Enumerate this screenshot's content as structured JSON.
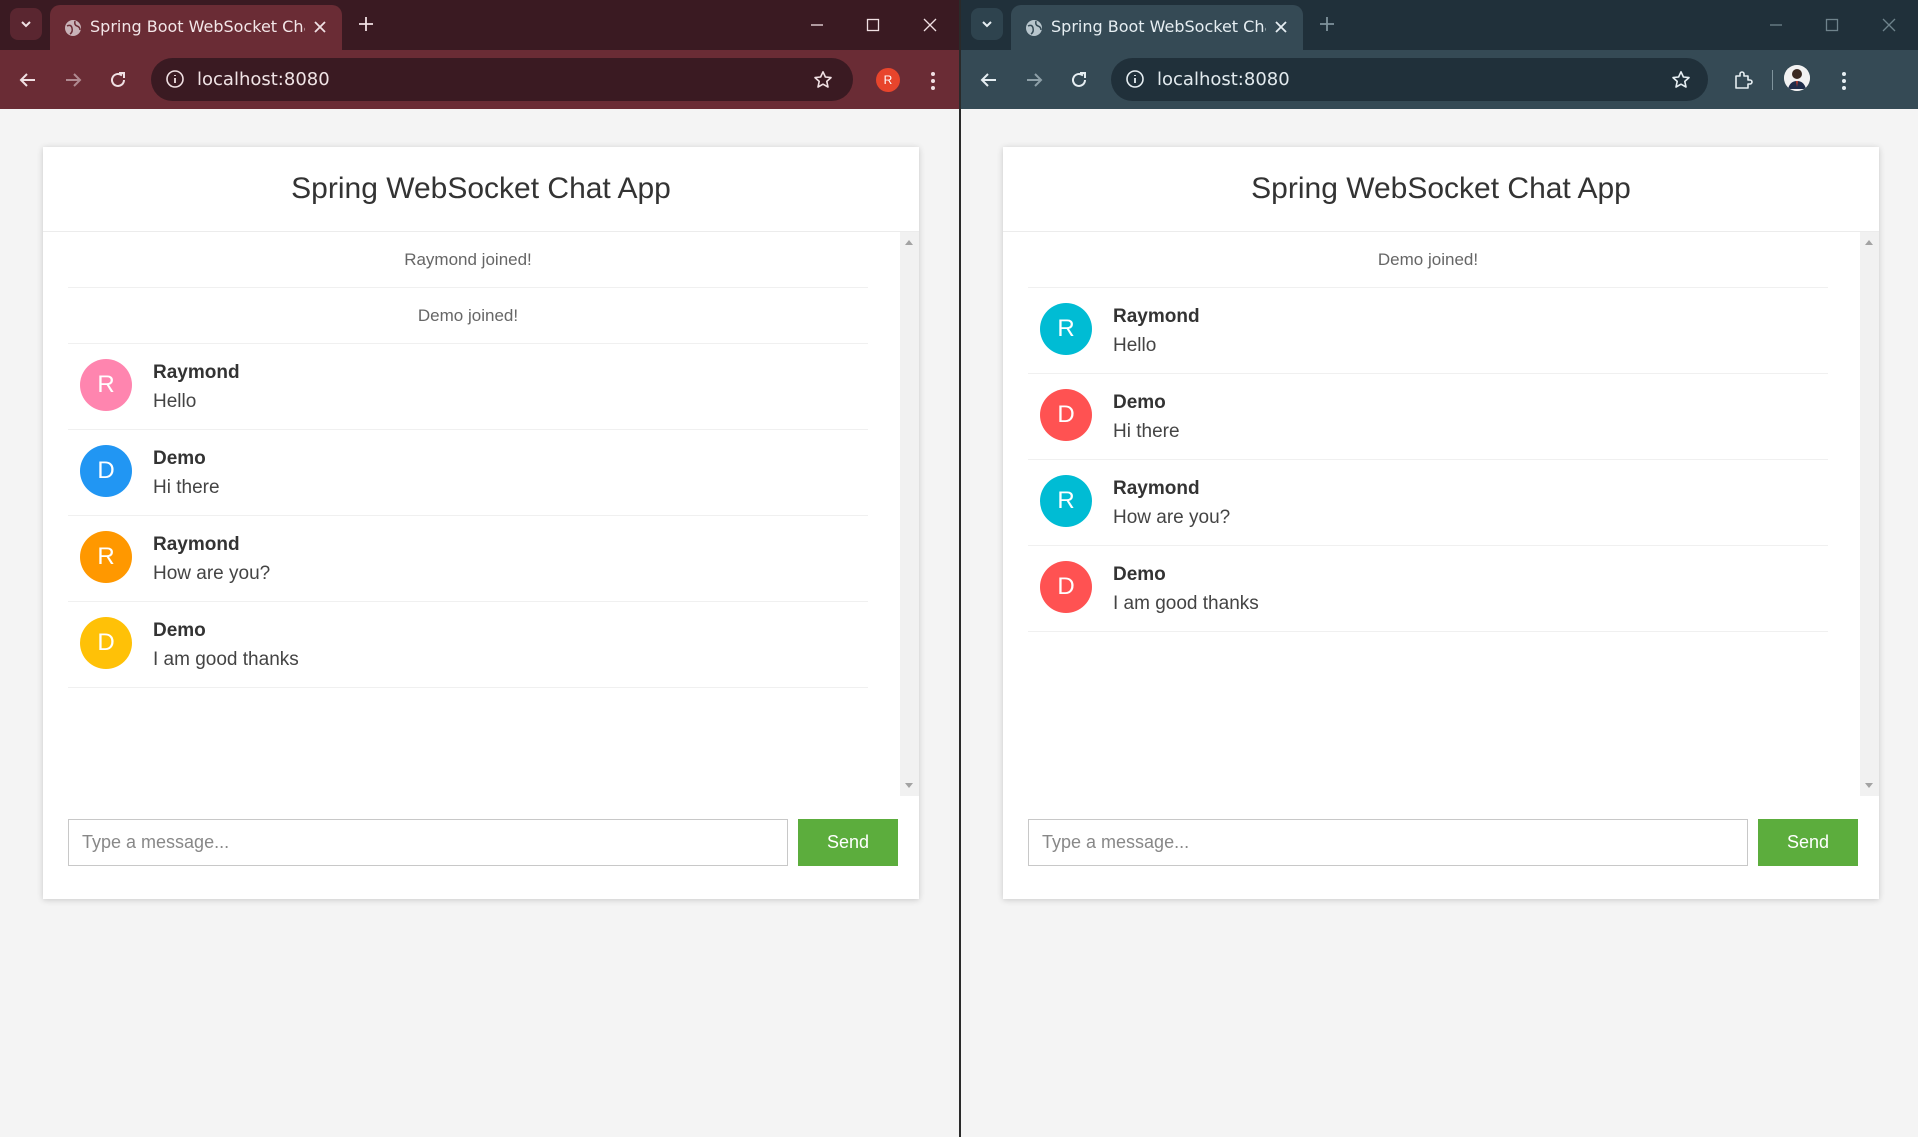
{
  "left": {
    "tab_title": "Spring Boot WebSocket Chat App",
    "url": "localhost:8080",
    "profile_initial": "R",
    "profile_color": "#e8452c",
    "app_title": "Spring WebSocket Chat App",
    "events": [
      {
        "text": "Raymond joined!"
      },
      {
        "text": "Demo joined!"
      }
    ],
    "messages": [
      {
        "initial": "R",
        "name": "Raymond",
        "text": "Hello",
        "color": "#ff85af"
      },
      {
        "initial": "D",
        "name": "Demo",
        "text": "Hi there",
        "color": "#2196f3"
      },
      {
        "initial": "R",
        "name": "Raymond",
        "text": "How are you?",
        "color": "#ff9800"
      },
      {
        "initial": "D",
        "name": "Demo",
        "text": "I am good thanks",
        "color": "#ffc107"
      }
    ],
    "input_placeholder": "Type a message...",
    "send_label": "Send"
  },
  "right": {
    "tab_title": "Spring Boot WebSocket Chat App",
    "url": "localhost:8080",
    "app_title": "Spring WebSocket Chat App",
    "events": [
      {
        "text": "Demo joined!"
      }
    ],
    "messages": [
      {
        "initial": "R",
        "name": "Raymond",
        "text": "Hello",
        "color": "#00bcd4"
      },
      {
        "initial": "D",
        "name": "Demo",
        "text": "Hi there",
        "color": "#ff5252"
      },
      {
        "initial": "R",
        "name": "Raymond",
        "text": "How are you?",
        "color": "#00bcd4"
      },
      {
        "initial": "D",
        "name": "Demo",
        "text": "I am good thanks",
        "color": "#ff5252"
      }
    ],
    "input_placeholder": "Type a message...",
    "send_label": "Send"
  },
  "theme": {
    "send_button": "#5cad3d",
    "left_frame": "#6a2c35",
    "right_frame": "#354a55"
  },
  "icons": [
    "tab-search-icon",
    "globe-icon",
    "close-icon",
    "plus-icon",
    "minimize-icon",
    "maximize-icon",
    "back-icon",
    "forward-icon",
    "reload-icon",
    "info-icon",
    "star-icon",
    "menu-icon",
    "extensions-icon"
  ]
}
